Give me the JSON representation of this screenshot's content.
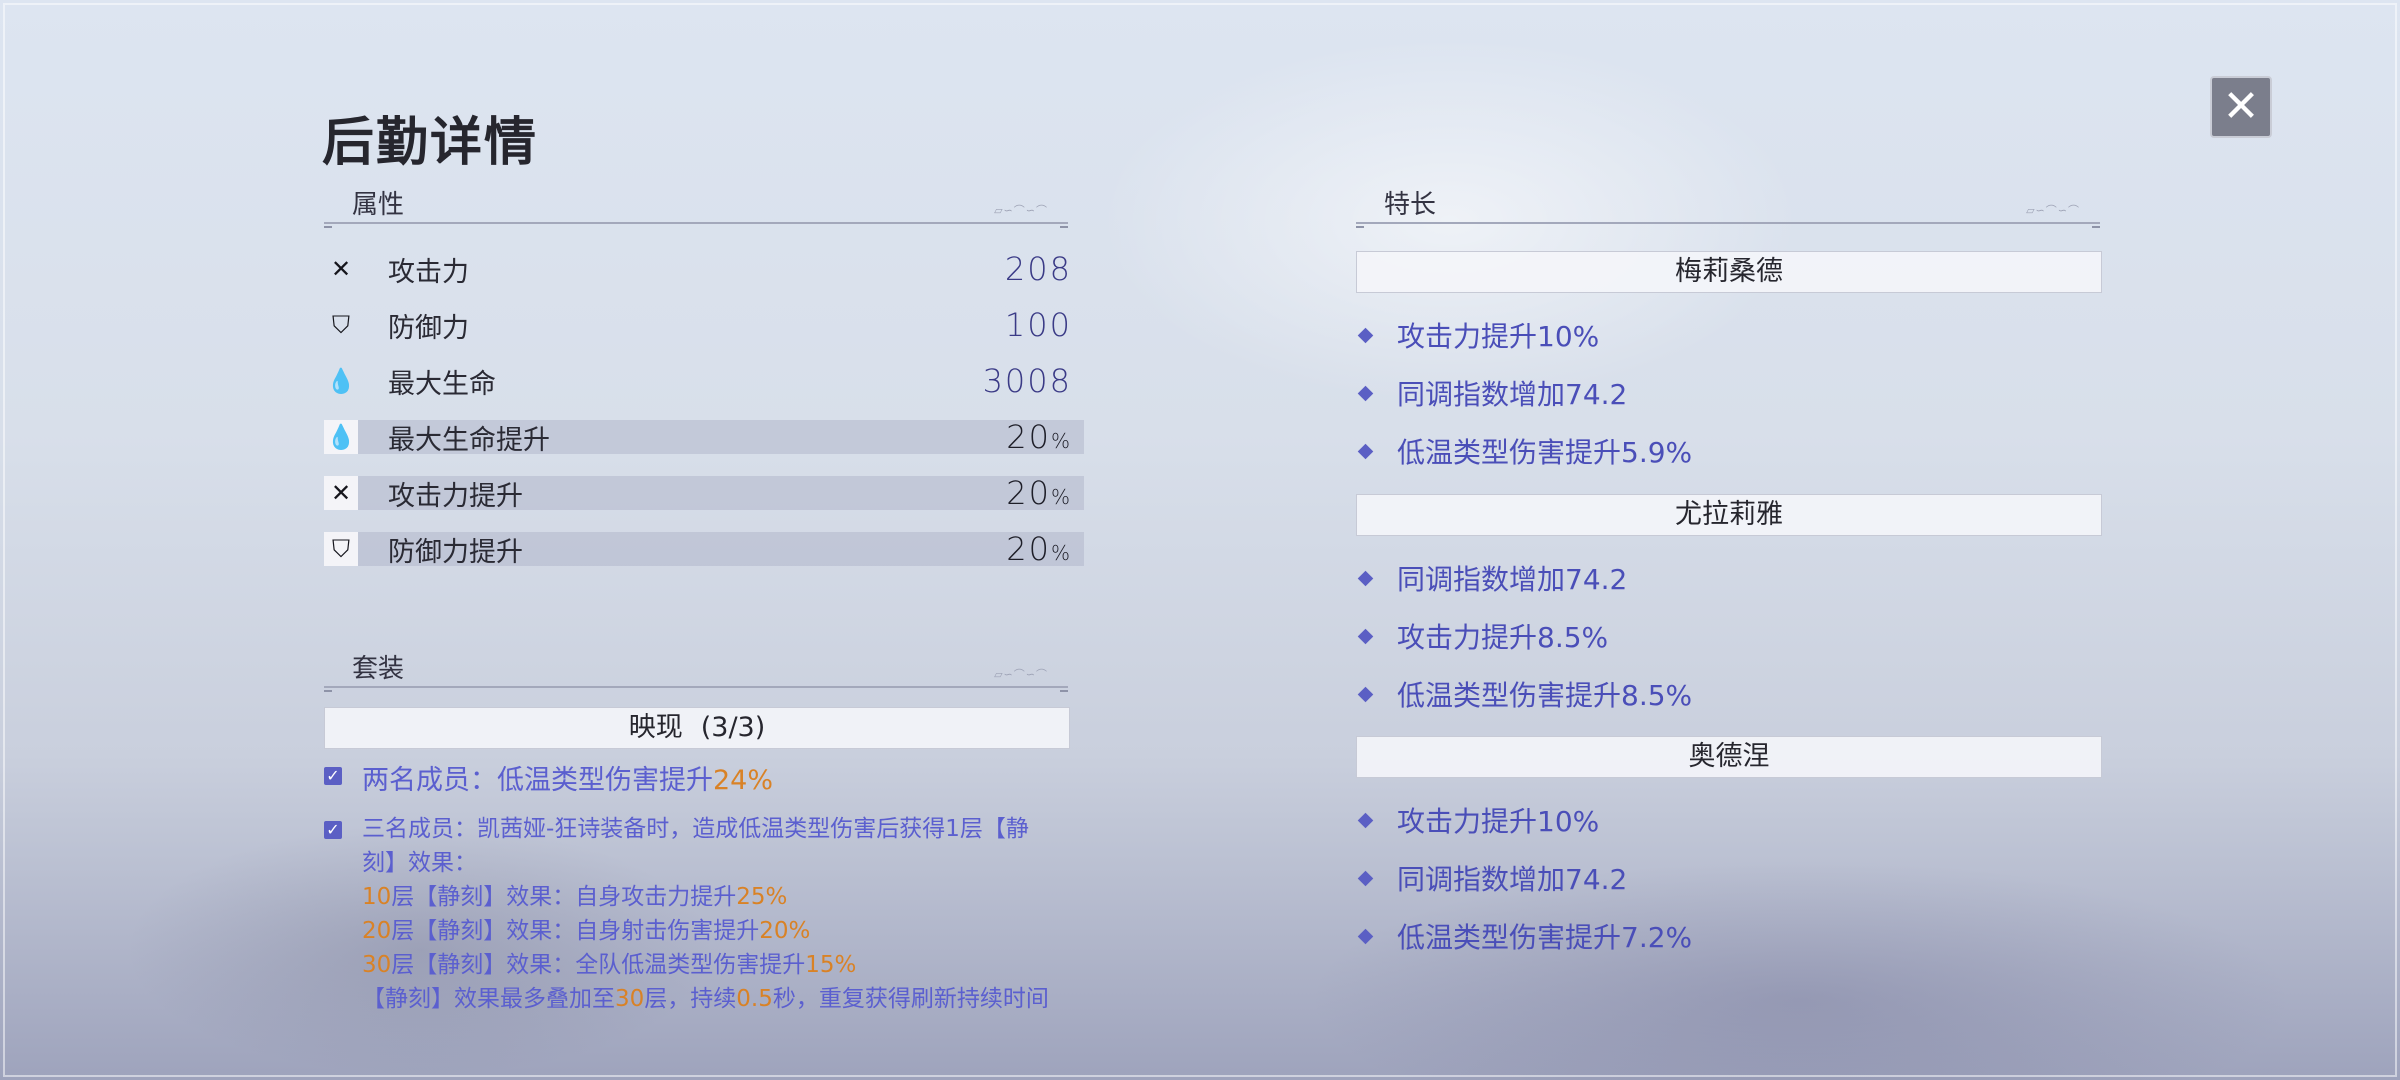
{
  "title": "后勤详情",
  "close_glyph": "✕",
  "attributes": {
    "header": "属性",
    "rows": [
      {
        "icon": "attack-icon",
        "glyph": "✕",
        "label": "攻击力",
        "value": "208",
        "suffix": ""
      },
      {
        "icon": "defense-icon",
        "glyph": "⛉",
        "label": "防御力",
        "value": "100",
        "suffix": ""
      },
      {
        "icon": "hp-icon",
        "glyph": "💧",
        "label": "最大生命",
        "value": "3008",
        "suffix": ""
      },
      {
        "icon": "hp-boost-icon",
        "glyph": "💧",
        "label": "最大生命提升",
        "value": "20",
        "suffix": "%"
      },
      {
        "icon": "attack-boost-icon",
        "glyph": "✕",
        "label": "攻击力提升",
        "value": "20",
        "suffix": "%"
      },
      {
        "icon": "defense-boost-icon",
        "glyph": "⛉",
        "label": "防御力提升",
        "value": "20",
        "suffix": "%"
      }
    ]
  },
  "set": {
    "header": "套装",
    "name": "映现",
    "count": "(3/3)",
    "check_glyph": "✓",
    "two_piece": {
      "prefix": "两名成员：低温类型伤害提升",
      "value": "24%"
    },
    "three_piece": {
      "line1": "三名成员：凯茜娅-狂诗装备时，造成低温类型伤害后获得1层【静",
      "line2": "刻】效果：",
      "tier1": {
        "num": "10",
        "mid": "层【静刻】效果：自身攻击力提升",
        "val": "25%"
      },
      "tier2": {
        "num": "20",
        "mid": "层【静刻】效果：自身射击伤害提升",
        "val": "20%"
      },
      "tier3": {
        "num": "30",
        "mid": "层【静刻】效果：全队低温类型伤害提升",
        "val": "15%"
      },
      "footer": {
        "a": "【静刻】效果最多叠加至",
        "b": "30",
        "c": "层，持续",
        "d": "0.5",
        "e": "秒，重复获得刷新持续时间"
      }
    }
  },
  "specialties": {
    "header": "特长",
    "groups": [
      {
        "name": "梅莉桑德",
        "items": [
          "攻击力提升10%",
          "同调指数增加74.2",
          "低温类型伤害提升5.9%"
        ]
      },
      {
        "name": "尤拉莉雅",
        "items": [
          "同调指数增加74.2",
          "攻击力提升8.5%",
          "低温类型伤害提升8.5%"
        ]
      },
      {
        "name": "奥德涅",
        "items": [
          "攻击力提升10%",
          "同调指数增加74.2",
          "低温类型伤害提升7.2%"
        ]
      }
    ]
  },
  "colors": {
    "accent": "#5b5fcf",
    "highlight": "#d98226"
  }
}
